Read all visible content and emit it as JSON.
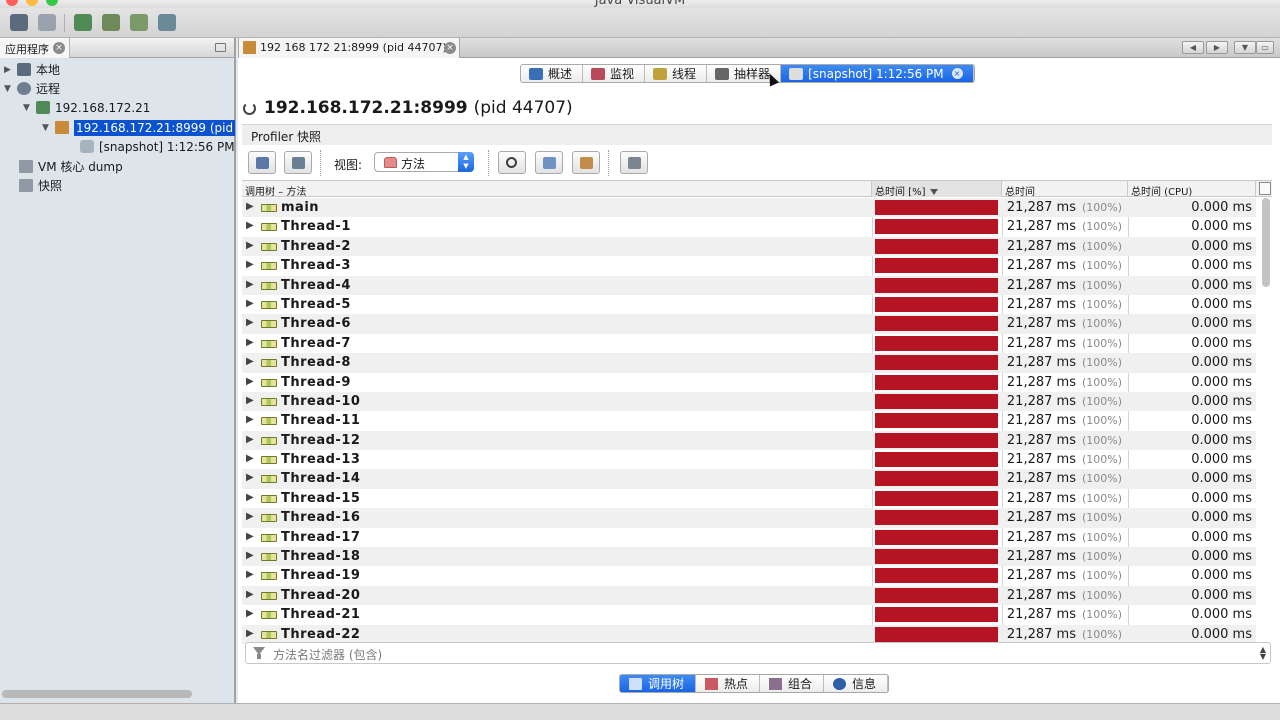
{
  "window": {
    "title": "Java VisualVM"
  },
  "left_panel": {
    "tab_label": "应用程序",
    "tree": [
      {
        "label": "本地",
        "icon": "computer-icon",
        "expanded": false
      },
      {
        "label": "远程",
        "icon": "network-icon",
        "expanded": true
      },
      {
        "label": "192.168.172.21",
        "icon": "remote-host-icon",
        "expanded": true
      },
      {
        "label": "192.168.172.21:8999 (pid",
        "icon": "java-app-icon",
        "expanded": true,
        "selected": true
      },
      {
        "label": "[snapshot] 1:12:56 PM",
        "icon": "snapshot-icon"
      },
      {
        "label": "VM 核心 dump",
        "icon": "coredump-icon"
      },
      {
        "label": "快照",
        "icon": "snapshots-icon"
      }
    ]
  },
  "document_tab": {
    "label": "192 168 172 21:8999 (pid 44707)"
  },
  "view_tabs": [
    {
      "label": "概述",
      "icon": "info-icon",
      "color": "#3a6fb8"
    },
    {
      "label": "监视",
      "icon": "monitor-chart-icon",
      "color": "#b84a5a"
    },
    {
      "label": "线程",
      "icon": "threads-icon",
      "color": "#c0a23a"
    },
    {
      "label": "抽样器",
      "icon": "sampler-icon",
      "color": "#666666"
    },
    {
      "label": "[snapshot] 1:12:56 PM",
      "icon": "snapshot-icon",
      "color": "#dddddd",
      "active": true
    }
  ],
  "header": {
    "title": "192.168.172.21:8999",
    "pid": "(pid 44707)"
  },
  "snapshot_section": {
    "title": "Profiler 快照"
  },
  "profiler_toolbar": {
    "view_label": "视图:",
    "view_value": "方法"
  },
  "table": {
    "columns": [
      "调用树 – 方法",
      "总时间 [%]",
      "总时间",
      "总时间 (CPU)"
    ],
    "sorted_column": "总时间 [%]",
    "rows": [
      {
        "name": "main",
        "total": "21,287 ms",
        "pct": "(100%)",
        "percent": 100,
        "cpu": "0.000 ms"
      },
      {
        "name": "Thread-1",
        "total": "21,287 ms",
        "pct": "(100%)",
        "percent": 100,
        "cpu": "0.000 ms"
      },
      {
        "name": "Thread-2",
        "total": "21,287 ms",
        "pct": "(100%)",
        "percent": 100,
        "cpu": "0.000 ms"
      },
      {
        "name": "Thread-3",
        "total": "21,287 ms",
        "pct": "(100%)",
        "percent": 100,
        "cpu": "0.000 ms"
      },
      {
        "name": "Thread-4",
        "total": "21,287 ms",
        "pct": "(100%)",
        "percent": 100,
        "cpu": "0.000 ms"
      },
      {
        "name": "Thread-5",
        "total": "21,287 ms",
        "pct": "(100%)",
        "percent": 100,
        "cpu": "0.000 ms"
      },
      {
        "name": "Thread-6",
        "total": "21,287 ms",
        "pct": "(100%)",
        "percent": 100,
        "cpu": "0.000 ms"
      },
      {
        "name": "Thread-7",
        "total": "21,287 ms",
        "pct": "(100%)",
        "percent": 100,
        "cpu": "0.000 ms"
      },
      {
        "name": "Thread-8",
        "total": "21,287 ms",
        "pct": "(100%)",
        "percent": 100,
        "cpu": "0.000 ms"
      },
      {
        "name": "Thread-9",
        "total": "21,287 ms",
        "pct": "(100%)",
        "percent": 100,
        "cpu": "0.000 ms"
      },
      {
        "name": "Thread-10",
        "total": "21,287 ms",
        "pct": "(100%)",
        "percent": 100,
        "cpu": "0.000 ms"
      },
      {
        "name": "Thread-11",
        "total": "21,287 ms",
        "pct": "(100%)",
        "percent": 100,
        "cpu": "0.000 ms"
      },
      {
        "name": "Thread-12",
        "total": "21,287 ms",
        "pct": "(100%)",
        "percent": 100,
        "cpu": "0.000 ms"
      },
      {
        "name": "Thread-13",
        "total": "21,287 ms",
        "pct": "(100%)",
        "percent": 100,
        "cpu": "0.000 ms"
      },
      {
        "name": "Thread-14",
        "total": "21,287 ms",
        "pct": "(100%)",
        "percent": 100,
        "cpu": "0.000 ms"
      },
      {
        "name": "Thread-15",
        "total": "21,287 ms",
        "pct": "(100%)",
        "percent": 100,
        "cpu": "0.000 ms"
      },
      {
        "name": "Thread-16",
        "total": "21,287 ms",
        "pct": "(100%)",
        "percent": 100,
        "cpu": "0.000 ms"
      },
      {
        "name": "Thread-17",
        "total": "21,287 ms",
        "pct": "(100%)",
        "percent": 100,
        "cpu": "0.000 ms"
      },
      {
        "name": "Thread-18",
        "total": "21,287 ms",
        "pct": "(100%)",
        "percent": 100,
        "cpu": "0.000 ms"
      },
      {
        "name": "Thread-19",
        "total": "21,287 ms",
        "pct": "(100%)",
        "percent": 100,
        "cpu": "0.000 ms"
      },
      {
        "name": "Thread-20",
        "total": "21,287 ms",
        "pct": "(100%)",
        "percent": 100,
        "cpu": "0.000 ms"
      },
      {
        "name": "Thread-21",
        "total": "21,287 ms",
        "pct": "(100%)",
        "percent": 100,
        "cpu": "0.000 ms"
      },
      {
        "name": "Thread-22",
        "total": "21,287 ms",
        "pct": "(100%)",
        "percent": 100,
        "cpu": "0.000 ms"
      }
    ]
  },
  "filter": {
    "placeholder": "方法名过滤器 (包含)"
  },
  "bottom_tabs": [
    {
      "label": "调用树",
      "icon": "call-tree-icon",
      "active": true
    },
    {
      "label": "热点",
      "icon": "hotspots-icon"
    },
    {
      "label": "组合",
      "icon": "combined-icon"
    },
    {
      "label": "信息",
      "icon": "info-icon"
    }
  ],
  "colors": {
    "selection": "#0b52d0",
    "active_tab": "#1a64e3",
    "time_bar": "#b51422"
  }
}
